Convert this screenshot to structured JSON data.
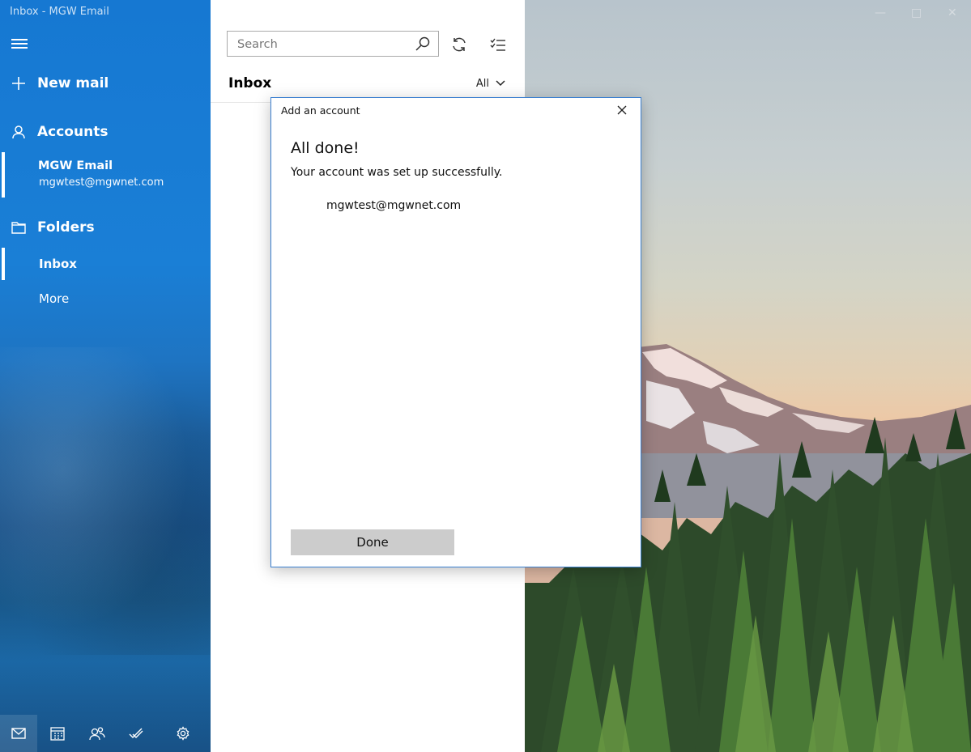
{
  "window": {
    "title": "Inbox - MGW Email",
    "controls": [
      "minimize-icon",
      "maximize-icon",
      "close-icon"
    ]
  },
  "sidebar": {
    "new_mail_label": "New mail",
    "accounts_label": "Accounts",
    "account": {
      "name": "MGW Email",
      "email": "mgwtest@mgwnet.com"
    },
    "folders_label": "Folders",
    "folders": [
      {
        "label": "Inbox",
        "selected": true
      },
      {
        "label": "More",
        "selected": false
      }
    ],
    "bottom_icons": [
      "mail-icon",
      "calendar-icon",
      "people-icon",
      "todo-icon",
      "settings-icon"
    ]
  },
  "list": {
    "search_placeholder": "Search",
    "folder_title": "Inbox",
    "filter_label": "All"
  },
  "dialog": {
    "title": "Add an account",
    "heading": "All done!",
    "message": "Your account was set up successfully.",
    "account_email": "mgwtest@mgwnet.com",
    "done_label": "Done"
  },
  "colors": {
    "sidebar_blue": "#1a7fd6",
    "dialog_border": "#3a7fd0",
    "done_button": "#cccccc"
  }
}
